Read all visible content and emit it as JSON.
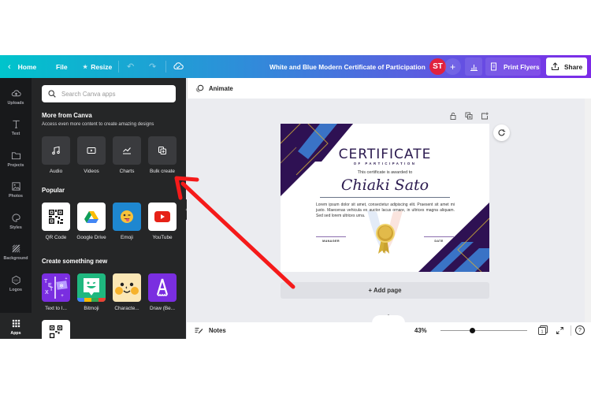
{
  "topbar": {
    "home_label": "Home",
    "file_label": "File",
    "resize_label": "Resize",
    "document_title": "White and Blue Modern Certificate of Participation",
    "avatar_initials": "ST",
    "add_collaborator": "+",
    "print_label": "Print Flyers",
    "share_label": "Share"
  },
  "rail": {
    "items": [
      {
        "label": "Uploads",
        "icon": "cloud-upload-icon"
      },
      {
        "label": "Text",
        "icon": "text-icon"
      },
      {
        "label": "Projects",
        "icon": "folder-icon"
      },
      {
        "label": "Photos",
        "icon": "photos-icon"
      },
      {
        "label": "Styles",
        "icon": "palette-icon"
      },
      {
        "label": "Background",
        "icon": "background-icon"
      },
      {
        "label": "Logos",
        "icon": "logo-icon"
      },
      {
        "label": "Apps",
        "icon": "apps-grid-icon",
        "active": true
      }
    ]
  },
  "panel": {
    "search_placeholder": "Search Canva apps",
    "more_title": "More from Canva",
    "more_subtitle": "Access even more content to create amazing designs",
    "more_items": [
      {
        "label": "Audio",
        "icon": "music-note-icon"
      },
      {
        "label": "Videos",
        "icon": "video-icon"
      },
      {
        "label": "Charts",
        "icon": "chart-line-icon"
      },
      {
        "label": "Bulk create",
        "icon": "bulk-create-icon"
      }
    ],
    "popular_title": "Popular",
    "popular_items": [
      {
        "label": "QR Code",
        "icon": "qr-code-icon"
      },
      {
        "label": "Google Drive",
        "icon": "google-drive-icon"
      },
      {
        "label": "Emoji",
        "icon": "emoji-icon"
      },
      {
        "label": "YouTube",
        "icon": "youtube-icon"
      }
    ],
    "create_title": "Create something new",
    "create_items": [
      {
        "label": "Text to I...",
        "icon": "text-to-image-icon"
      },
      {
        "label": "Bitmoji",
        "icon": "bitmoji-icon"
      },
      {
        "label": "Characte...",
        "icon": "character-icon"
      },
      {
        "label": "Draw (Be...",
        "icon": "draw-icon"
      }
    ]
  },
  "editor": {
    "animate_label": "Animate",
    "add_page_label": "+ Add page",
    "notes_label": "Notes",
    "zoom_level": "43%",
    "zoom_fraction": 0.37,
    "page_count": "1"
  },
  "certificate": {
    "title": "CERTIFICATE",
    "subtitle": "OF PARTICIPATION",
    "awarded_text": "This certificate is awarded to",
    "recipient": "Chiaki Sato",
    "body": "Lorem ipsum dolor sit amet, consectetur adipiscing elit. Praesent sit amet mi justo. Maecenas vehicula ex auctor lacus ornare, in ultrices magna aliquam. Sed sed lorem ultrices urna.",
    "signature_left": "MANAGER",
    "signature_right": "DATE"
  },
  "colors": {
    "accent_red": "#e0213e",
    "annotation_arrow": "#f51a1a",
    "cert_purple": "#2e1153",
    "cert_blue": "#3a73c6",
    "cert_gold": "#d4af37"
  }
}
